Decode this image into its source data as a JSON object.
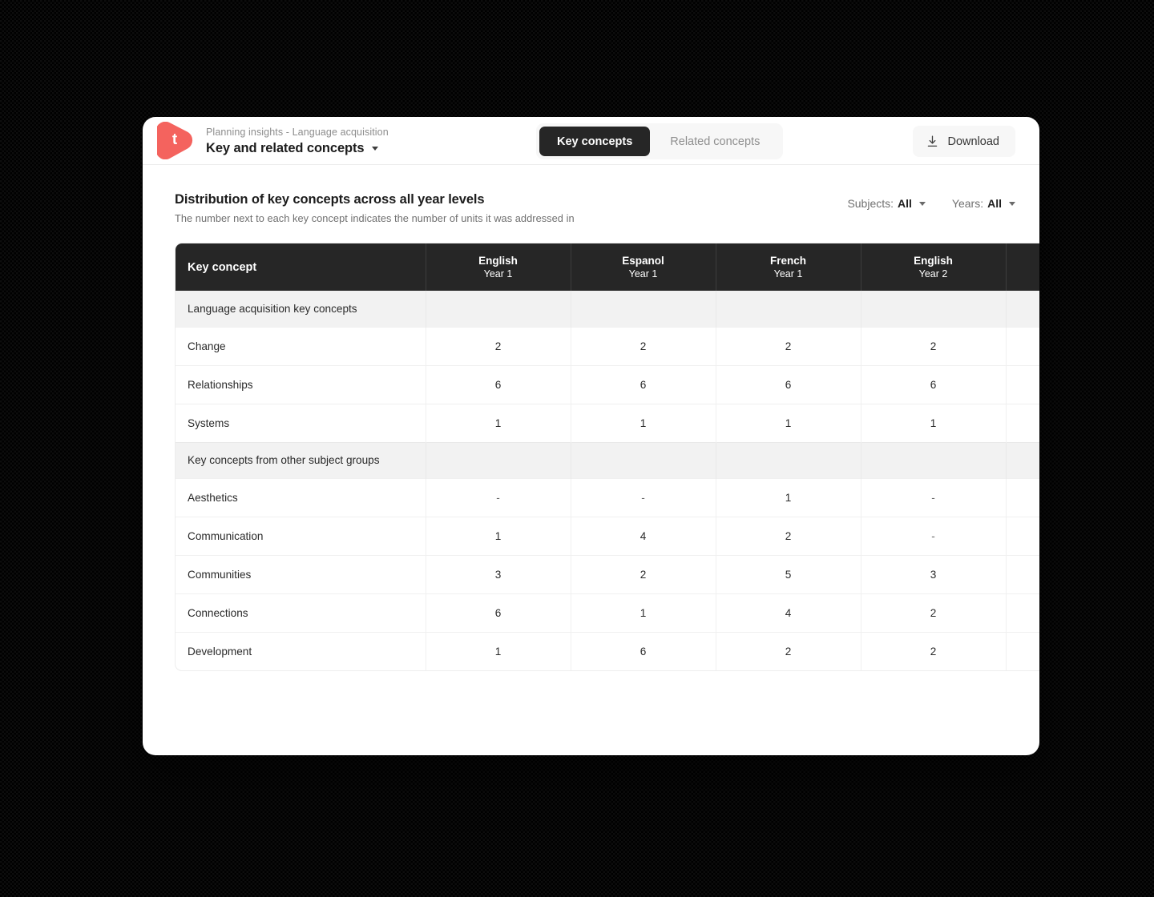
{
  "topbar": {
    "logo_letter": "t",
    "logo_color": "#f4635e",
    "breadcrumb": "Planning insights - Language acquisition",
    "page_title": "Key and related concepts",
    "title_caret_icon": "chevron-down-icon",
    "tabs": [
      {
        "label": "Key concepts",
        "active": true
      },
      {
        "label": "Related concepts",
        "active": false
      }
    ],
    "download": {
      "label": "Download",
      "icon": "download-icon"
    }
  },
  "content": {
    "heading": "Distribution of key concepts across all year levels",
    "subheading": "The number next to each key concept indicates the number of units it was addressed in",
    "filters": [
      {
        "label": "Subjects:",
        "value": "All",
        "caret_icon": "chevron-down-icon"
      },
      {
        "label": "Years:",
        "value": "All",
        "caret_icon": "chevron-down-icon"
      }
    ]
  },
  "table": {
    "columns": [
      {
        "name": "Key concept",
        "year": ""
      },
      {
        "name": "English",
        "year": "Year 1"
      },
      {
        "name": "Espanol",
        "year": "Year 1"
      },
      {
        "name": "French",
        "year": "Year 1"
      },
      {
        "name": "English",
        "year": "Year 2"
      },
      {
        "name": "",
        "year": ""
      }
    ],
    "rows": [
      {
        "type": "section",
        "label": "Language acquisition key concepts",
        "values": [
          "",
          "",
          "",
          "",
          ""
        ]
      },
      {
        "type": "data",
        "label": "Change",
        "values": [
          "2",
          "2",
          "2",
          "2",
          ""
        ]
      },
      {
        "type": "data",
        "label": "Relationships",
        "values": [
          "6",
          "6",
          "6",
          "6",
          ""
        ]
      },
      {
        "type": "data",
        "label": "Systems",
        "values": [
          "1",
          "1",
          "1",
          "1",
          ""
        ]
      },
      {
        "type": "section",
        "label": "Key concepts from other subject groups",
        "values": [
          "",
          "",
          "",
          "",
          ""
        ]
      },
      {
        "type": "data",
        "label": "Aesthetics",
        "values": [
          "-",
          "-",
          "1",
          "-",
          ""
        ]
      },
      {
        "type": "data",
        "label": "Communication",
        "values": [
          "1",
          "4",
          "2",
          "-",
          ""
        ]
      },
      {
        "type": "data",
        "label": "Communities",
        "values": [
          "3",
          "2",
          "5",
          "3",
          ""
        ]
      },
      {
        "type": "data",
        "label": "Connections",
        "values": [
          "6",
          "1",
          "4",
          "2",
          ""
        ]
      },
      {
        "type": "data",
        "label": "Development",
        "values": [
          "1",
          "6",
          "2",
          "2",
          ""
        ]
      }
    ]
  }
}
